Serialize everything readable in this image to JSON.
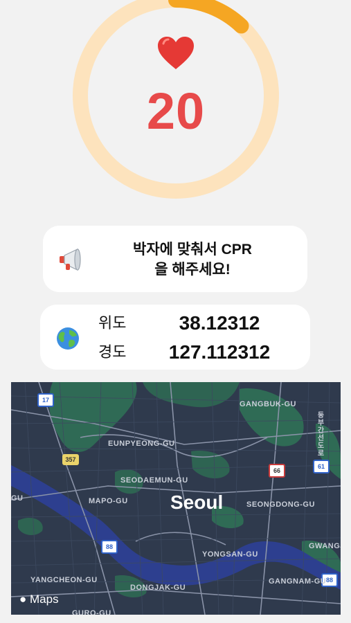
{
  "heart_rate": {
    "value": "20",
    "icon": "heart-icon",
    "progress": 0.12,
    "ring_color": "#fde3bd",
    "progress_color": "#f5a623",
    "value_color": "#e74a4a"
  },
  "cpr_card": {
    "icon": "megaphone-icon",
    "line1": "박자에 맞춰서 CPR",
    "line2": "을 해주세요!"
  },
  "location_card": {
    "icon": "globe-icon",
    "latitude_label": "위도",
    "latitude_value": "38.12312",
    "longitude_label": "경도",
    "longitude_value": "127.112312"
  },
  "map": {
    "city": "Seoul",
    "attribution": " Maps",
    "districts": {
      "gangbuk": "GANGBUK-GU",
      "eunpyeong": "EUNPYEONG-GU",
      "seodaemun": "SEODAEMUN-GU",
      "mapo": "MAPO-GU",
      "seongdong": "SEONGDONG-GU",
      "yongsan": "YONGSAN-GU",
      "gwangjin": "GWANGJ",
      "yangcheon": "YANGCHEON-GU",
      "dongjak": "DONGJAK-GU",
      "gangnam": "GANGNAM-GU",
      "guro": "GURO-GU",
      "gu_left": "GU"
    },
    "road_shields": {
      "r17": "17",
      "r357": "357",
      "r66": "66",
      "r61": "61",
      "r88": "88",
      "r88b": "88",
      "r88c": "88"
    },
    "expressway_label": "동부간선도로"
  }
}
